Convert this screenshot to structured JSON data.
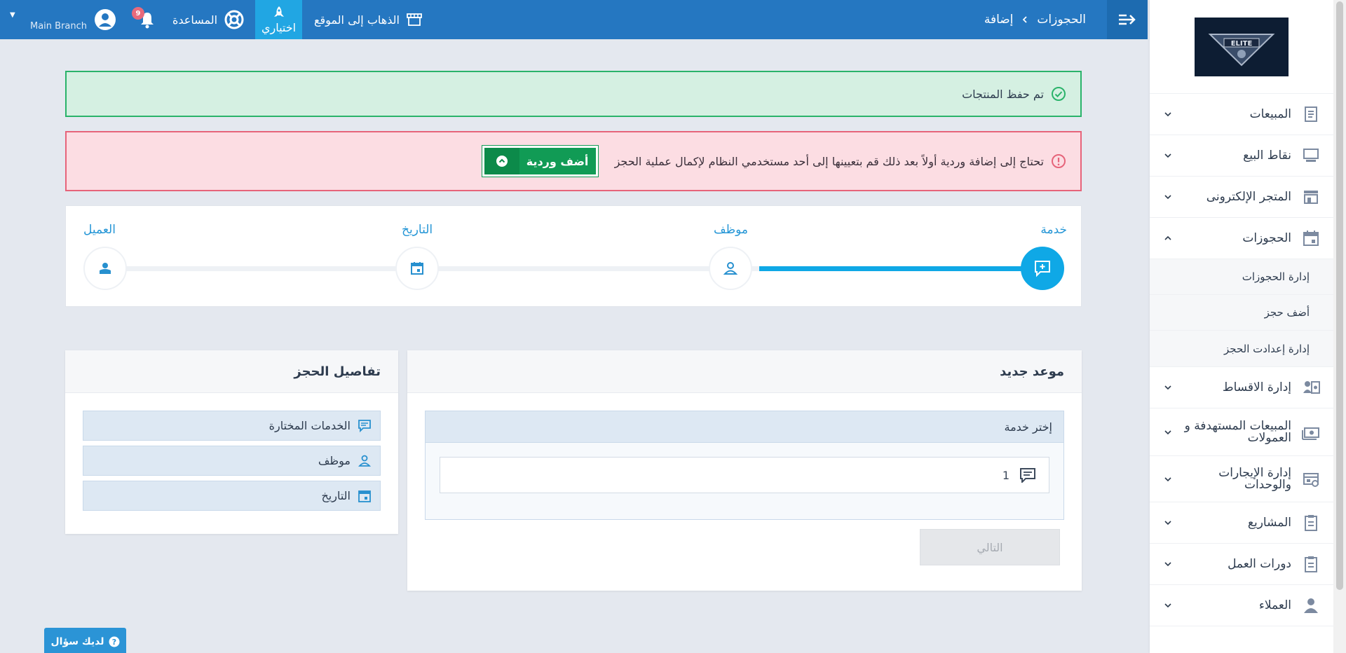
{
  "topbar": {
    "breadcrumb_root": "الحجوزات",
    "breadcrumb_current": "إضافة",
    "go_to_site": "الذهاب إلى الموقع",
    "trial": "اختياري",
    "help": "المساعدة",
    "notifications_count": "9",
    "branch": "Main Branch"
  },
  "sidebar": {
    "logo_text": "ELITE",
    "items": [
      {
        "label": "المبيعات",
        "icon": "receipt-icon"
      },
      {
        "label": "نقاط البيع",
        "icon": "pos-icon"
      },
      {
        "label": "المتجر الإلكترونى",
        "icon": "store-icon"
      },
      {
        "label": "الحجوزات",
        "icon": "calendar-icon"
      },
      {
        "label": "إدارة الاقساط",
        "icon": "installments-icon"
      },
      {
        "label": "المبيعات المستهدفة و العمولات",
        "icon": "money-icon"
      },
      {
        "label": "إدارة الإيجارات والوحدات",
        "icon": "rentals-icon"
      },
      {
        "label": "المشاريع",
        "icon": "clipboard-icon"
      },
      {
        "label": "دورات العمل",
        "icon": "clipboard-icon"
      },
      {
        "label": "العملاء",
        "icon": "client-icon"
      }
    ],
    "sub_items": [
      "إدارة الحجوزات",
      "أضف حجز",
      "إدارة إعدادت الحجز"
    ]
  },
  "alerts": {
    "success": "تم حفظ المنتجات",
    "danger": "تحتاج إلى إضافة وردية أولاً بعد ذلك قم بتعيينها إلى أحد مستخدمي النظام لإكمال عملية الحجز",
    "add_shift": "أضف وردية"
  },
  "stepper": {
    "steps": [
      "خدمة",
      "موظف",
      "التاريخ",
      "العميل"
    ],
    "progress": 0.25
  },
  "new_appointment": {
    "title": "موعد جديد",
    "choose_service": "إختر خدمة",
    "service_value": "1",
    "next": "التالي"
  },
  "booking_details": {
    "title": "تفاصيل الحجز",
    "rows": [
      "الخدمات المختارة",
      "موظف",
      "التاريخ"
    ]
  },
  "question_button": "لديك سؤال",
  "colors": {
    "topbar": "#2577c1",
    "accent": "#0fa8e6",
    "success": "#2ab36a",
    "danger": "#e6647a",
    "button_green": "#119b55"
  }
}
